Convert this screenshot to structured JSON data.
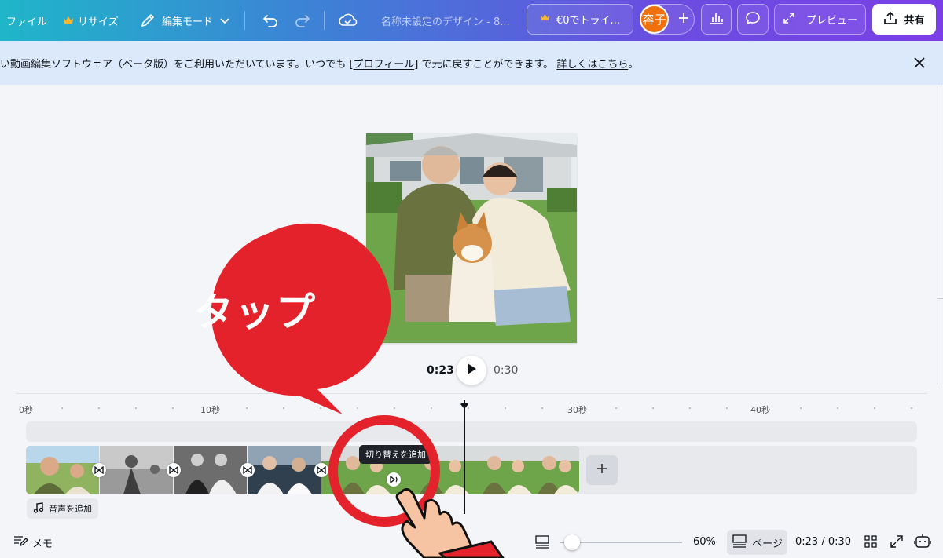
{
  "topbar": {
    "file_label": "ファイル",
    "resize_label": "リサイズ",
    "edit_mode_label": "編集モード",
    "doc_title": "名称未設定のデザイン - 8...",
    "trial_label": "€0でトライ...",
    "avatar_label": "容子",
    "preview_label": "プレビュー",
    "share_label": "共有"
  },
  "banner": {
    "message_before": "い動画編集ソフトウェア（ベータ版）をご利用いただいています。いつでも [",
    "profile_link": "プロフィール",
    "message_after": "] で元に戻すことができます。",
    "learn_more": "詳しくはこちら",
    "period": "。"
  },
  "playback": {
    "current_time": "0:23",
    "total_time": "0:30"
  },
  "timeline": {
    "ruler_labels": [
      "0秒",
      "10秒",
      "30秒",
      "40秒"
    ],
    "tooltip": "切り替えを追加",
    "add_audio_label": "音声を追加",
    "clip_count": 5
  },
  "bottombar": {
    "notes_label": "メモ",
    "zoom_percent": "60%",
    "zoom_level": 0.1,
    "page_label": "ページ",
    "time_readout": "0:23 / 0:30"
  },
  "annotation": {
    "callout_text": "タップ"
  },
  "colors": {
    "accent": "#7a3fe6",
    "banner_bg": "#dbe9fb",
    "callout_red": "#e4222b",
    "avatar_orange": "#f0700d"
  },
  "icons": [
    "crown-icon",
    "pencil-icon",
    "chevron-down-icon",
    "undo-icon",
    "redo-icon",
    "cloud-check-icon",
    "plus-icon",
    "chart-icon",
    "comment-icon",
    "expand-icon",
    "upload-icon",
    "close-icon",
    "play-icon",
    "transition-icon",
    "music-note-icon",
    "notes-icon",
    "layout-icon",
    "grid-icon",
    "fullscreen-icon",
    "assistant-icon",
    "hand-pointer-icon"
  ]
}
